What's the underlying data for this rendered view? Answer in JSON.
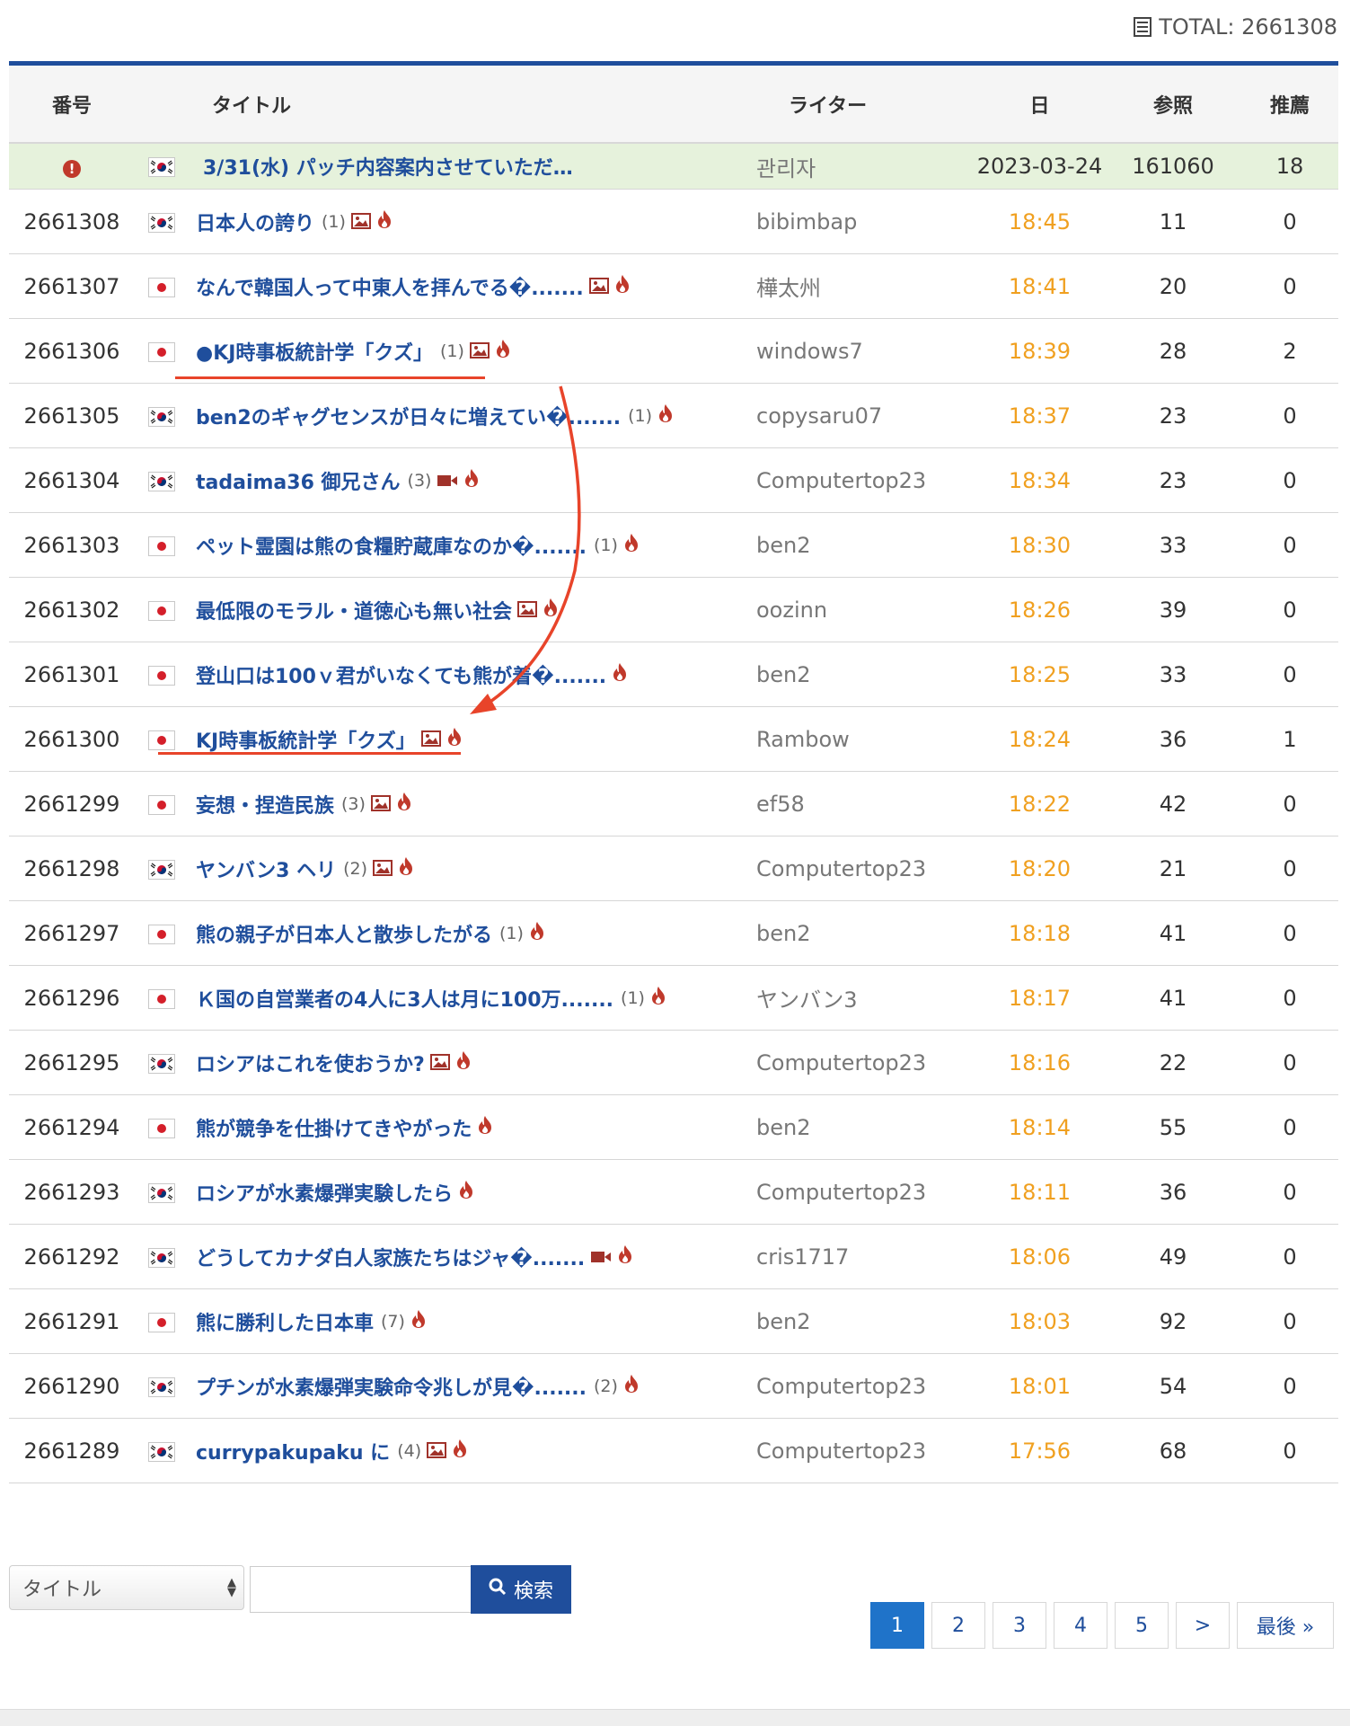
{
  "header": {
    "total_label": "TOTAL: 2661308"
  },
  "columns": {
    "no": "番号",
    "title": "タイトル",
    "writer": "ライター",
    "date": "日",
    "views": "参照",
    "recommend": "推薦"
  },
  "notice": {
    "flag": "kr",
    "title": "3/31(水) パッチ内容案内させていただ…",
    "writer": "관리자",
    "date": "2023-03-24",
    "views": "161060",
    "recommend": "18"
  },
  "posts": [
    {
      "no": "2661308",
      "flag": "kr",
      "title": "日本人の誇り",
      "comments": "(1)",
      "image": true,
      "video": false,
      "writer": "bibimbap",
      "time": "18:45",
      "views": "11",
      "recommend": "0"
    },
    {
      "no": "2661307",
      "flag": "jp",
      "title": "なんで韓国人って中東人を拝んでる�.......",
      "comments": "",
      "image": true,
      "video": false,
      "writer": "樺太州",
      "time": "18:41",
      "views": "20",
      "recommend": "0"
    },
    {
      "no": "2661306",
      "flag": "jp",
      "title": "●KJ時事板統計学「クズ」",
      "comments": "(1)",
      "image": true,
      "video": false,
      "writer": "windows7",
      "time": "18:39",
      "views": "28",
      "recommend": "2"
    },
    {
      "no": "2661305",
      "flag": "kr",
      "title": "ben2のギャグセンスが日々に増えてい�.......",
      "comments": "(1)",
      "image": false,
      "video": false,
      "writer": "copysaru07",
      "time": "18:37",
      "views": "23",
      "recommend": "0"
    },
    {
      "no": "2661304",
      "flag": "kr",
      "title": "tadaima36 御兄さん",
      "comments": "(3)",
      "image": false,
      "video": true,
      "writer": "Computertop23",
      "time": "18:34",
      "views": "23",
      "recommend": "0"
    },
    {
      "no": "2661303",
      "flag": "jp",
      "title": "ペット霊園は熊の食糧貯蔵庫なのか�.......",
      "comments": "(1)",
      "image": false,
      "video": false,
      "writer": "ben2",
      "time": "18:30",
      "views": "33",
      "recommend": "0"
    },
    {
      "no": "2661302",
      "flag": "jp",
      "title": "最低限のモラル・道徳心も無い社会",
      "comments": "",
      "image": true,
      "video": false,
      "writer": "oozinn",
      "time": "18:26",
      "views": "39",
      "recommend": "0"
    },
    {
      "no": "2661301",
      "flag": "jp",
      "title": "登山口は100ｖ君がいなくても熊が着�.......",
      "comments": "",
      "image": false,
      "video": false,
      "writer": "ben2",
      "time": "18:25",
      "views": "33",
      "recommend": "0"
    },
    {
      "no": "2661300",
      "flag": "jp",
      "title": "KJ時事板統計学「クズ」",
      "comments": "",
      "image": true,
      "video": false,
      "writer": "Rambow",
      "time": "18:24",
      "views": "36",
      "recommend": "1"
    },
    {
      "no": "2661299",
      "flag": "jp",
      "title": "妄想・捏造民族",
      "comments": "(3)",
      "image": true,
      "video": false,
      "writer": "ef58",
      "time": "18:22",
      "views": "42",
      "recommend": "0"
    },
    {
      "no": "2661298",
      "flag": "kr",
      "title": "ヤンバン3 ヘリ",
      "comments": "(2)",
      "image": true,
      "video": false,
      "writer": "Computertop23",
      "time": "18:20",
      "views": "21",
      "recommend": "0"
    },
    {
      "no": "2661297",
      "flag": "jp",
      "title": "熊の親子が日本人と散歩したがる",
      "comments": "(1)",
      "image": false,
      "video": false,
      "writer": "ben2",
      "time": "18:18",
      "views": "41",
      "recommend": "0"
    },
    {
      "no": "2661296",
      "flag": "jp",
      "title": "Ｋ国の自営業者の4人に3人は月に100万.......",
      "comments": "(1)",
      "image": false,
      "video": false,
      "writer": "ヤンバン3",
      "time": "18:17",
      "views": "41",
      "recommend": "0"
    },
    {
      "no": "2661295",
      "flag": "kr",
      "title": "ロシアはこれを使おうか?",
      "comments": "",
      "image": true,
      "video": false,
      "writer": "Computertop23",
      "time": "18:16",
      "views": "22",
      "recommend": "0"
    },
    {
      "no": "2661294",
      "flag": "jp",
      "title": "熊が競争を仕掛けてきやがった",
      "comments": "",
      "image": false,
      "video": false,
      "writer": "ben2",
      "time": "18:14",
      "views": "55",
      "recommend": "0"
    },
    {
      "no": "2661293",
      "flag": "kr",
      "title": "ロシアが水素爆弾実験したら",
      "comments": "",
      "image": false,
      "video": false,
      "writer": "Computertop23",
      "time": "18:11",
      "views": "36",
      "recommend": "0"
    },
    {
      "no": "2661292",
      "flag": "kr",
      "title": "どうしてカナダ白人家族たちはジャ�.......",
      "comments": "",
      "image": false,
      "video": true,
      "writer": "cris1717",
      "time": "18:06",
      "views": "49",
      "recommend": "0"
    },
    {
      "no": "2661291",
      "flag": "jp",
      "title": "熊に勝利した日本車",
      "comments": "(7)",
      "image": false,
      "video": false,
      "writer": "ben2",
      "time": "18:03",
      "views": "92",
      "recommend": "0"
    },
    {
      "no": "2661290",
      "flag": "kr",
      "title": "プチンが水素爆弾実験命令兆しが見�.......",
      "comments": "(2)",
      "image": false,
      "video": false,
      "writer": "Computertop23",
      "time": "18:01",
      "views": "54",
      "recommend": "0"
    },
    {
      "no": "2661289",
      "flag": "kr",
      "title": "currypakupaku に",
      "comments": "(4)",
      "image": true,
      "video": false,
      "writer": "Computertop23",
      "time": "17:56",
      "views": "68",
      "recommend": "0"
    }
  ],
  "search": {
    "field_selected": "タイトル",
    "button_label": "検索",
    "query": ""
  },
  "pagination": {
    "pages": [
      "1",
      "2",
      "3",
      "4",
      "5"
    ],
    "active": "1",
    "next_label": ">",
    "last_label": "最後 »"
  },
  "colors": {
    "accent": "#1f4e9c",
    "time": "#f0a020",
    "notice_bg": "#e6f2dc",
    "hot": "#c0392b",
    "annotation": "#e8442a"
  }
}
